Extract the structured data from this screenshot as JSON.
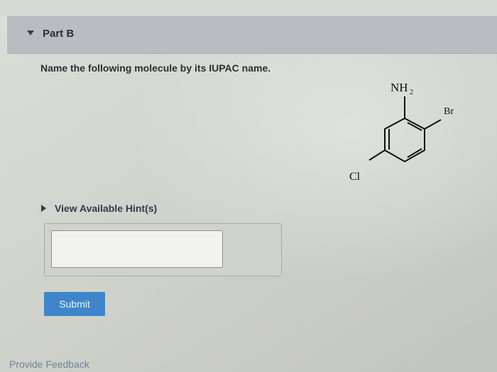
{
  "part": {
    "title": "Part B"
  },
  "question": {
    "prompt": "Name the following molecule by its IUPAC name."
  },
  "molecule": {
    "labels": {
      "amine_main": "NH",
      "amine_sub": "2",
      "bromo": "Br",
      "chloro": "Cl"
    }
  },
  "hint": {
    "label": "View Available Hint(s)"
  },
  "answer": {
    "value": ""
  },
  "actions": {
    "submit_label": "Submit",
    "feedback_label": "Provide Feedback"
  }
}
